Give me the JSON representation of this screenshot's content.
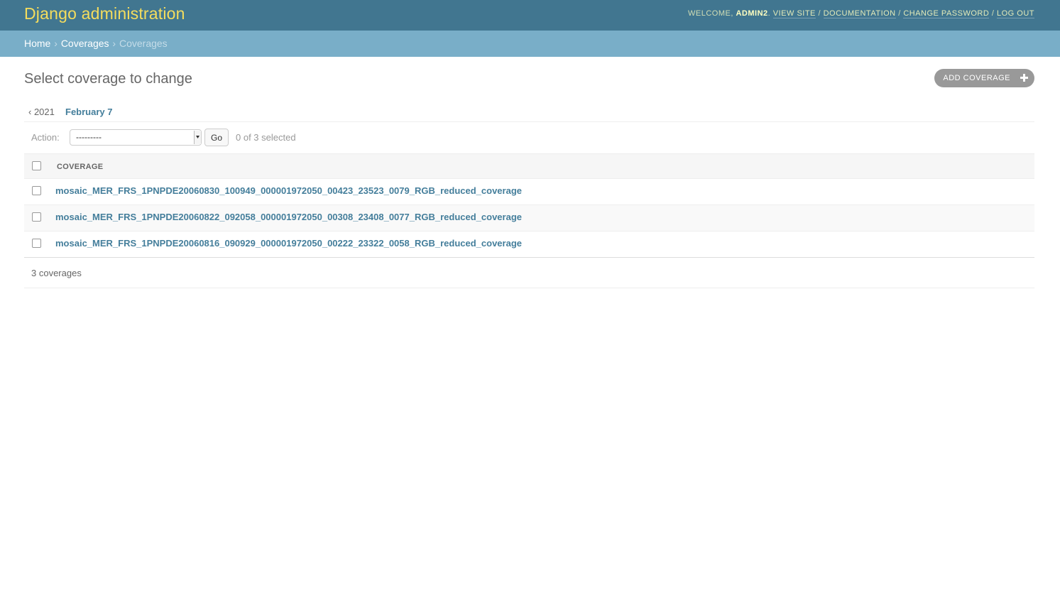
{
  "header": {
    "site_title": "Django administration",
    "welcome": "Welcome,",
    "username": "admin2",
    "view_site": "View site",
    "documentation": "Documentation",
    "change_password": "Change password",
    "log_out": "Log out",
    "separator": "/"
  },
  "breadcrumbs": {
    "home": "Home",
    "app": "Coverages",
    "current": "Coverages",
    "arrow": "›"
  },
  "page": {
    "title": "Select coverage to change",
    "add_button": "Add coverage"
  },
  "date_hierarchy": {
    "back": "‹ 2021",
    "current": "February 7"
  },
  "actions": {
    "label": "Action:",
    "selected_option": "---------",
    "go_label": "Go",
    "counter": "0 of 3 selected"
  },
  "table": {
    "column_header": "Coverage",
    "rows": [
      {
        "name": "mosaic_MER_FRS_1PNPDE20060830_100949_000001972050_00423_23523_0079_RGB_reduced_coverage"
      },
      {
        "name": "mosaic_MER_FRS_1PNPDE20060822_092058_000001972050_00308_23408_0077_RGB_reduced_coverage"
      },
      {
        "name": "mosaic_MER_FRS_1PNPDE20060816_090929_000001972050_00222_23322_0058_RGB_reduced_coverage"
      }
    ]
  },
  "paginator": {
    "count_text": "3 coverages"
  },
  "colors": {
    "header_bg": "#417690",
    "branding": "#f5dd5d",
    "breadcrumbs_bg": "#79aec8",
    "link": "#447e9b",
    "add_button_bg": "#999999"
  }
}
